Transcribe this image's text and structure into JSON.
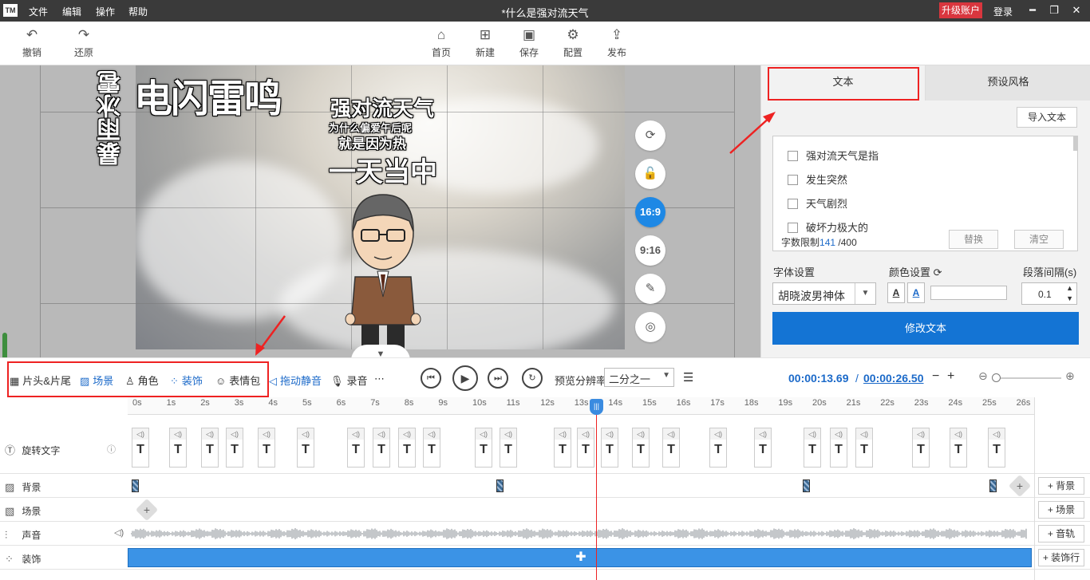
{
  "titlebar": {
    "logo": "TM",
    "menus": [
      "文件",
      "编辑",
      "操作",
      "帮助"
    ],
    "title": "*什么是强对流天气",
    "upgrade": "升级账户",
    "login": "登录"
  },
  "toolbar": {
    "undo": "撤销",
    "redo": "还原",
    "home": "首页",
    "new": "新建",
    "save": "保存",
    "config": "配置",
    "publish": "发布"
  },
  "stage": {
    "vertical_text": "电闪雷鸣",
    "side_text": "暴雨冰雹",
    "line1": "强对流天气",
    "line2": "为什么偏爱午后呢",
    "line3": "就是因为热",
    "line4": "一天当中"
  },
  "side_buttons": {
    "ratio_169": "16:9",
    "ratio_916": "9:16"
  },
  "right_panel": {
    "tab_text": "文本",
    "tab_preset": "预设风格",
    "import": "导入文本",
    "items": [
      "强对流天气是指",
      "发生突然",
      "天气剧烈",
      "破坏力极大的"
    ],
    "char_limit_label": "字数限制",
    "char_count": "141",
    "char_max": "/400",
    "replace": "替换",
    "clear": "清空",
    "font_settings": "字体设置",
    "color_settings": "颜色设置",
    "paragraph_interval": "段落间隔(s)",
    "font_name": "胡晓波男神体",
    "interval_value": "0.1",
    "modify": "修改文本"
  },
  "controls": {
    "head_tail": "片头&片尾",
    "scene": "场景",
    "role": "角色",
    "decor": "装饰",
    "emoji": "表情包",
    "drag_mute": "拖动静音",
    "record": "录音",
    "preview_res_label": "预览分辨率",
    "preview_res_value": "二分之一",
    "current_time": "00:00:13.69",
    "separator": "/",
    "total_time": "00:00:26.50",
    "minus": "−",
    "plus": "+"
  },
  "ruler": [
    "0s",
    "1s",
    "2s",
    "3s",
    "4s",
    "5s",
    "6s",
    "7s",
    "8s",
    "9s",
    "10s",
    "11s",
    "12s",
    "13s",
    "14s",
    "15s",
    "16s",
    "17s",
    "18s",
    "19s",
    "20s",
    "21s",
    "22s",
    "23s",
    "24s",
    "25s",
    "26s"
  ],
  "tracks": {
    "rotate_text": "旋转文字",
    "background": "背景",
    "scene": "场景",
    "audio": "声音",
    "decor": "装饰",
    "add_background": "背景",
    "add_scene": "场景",
    "add_audio": "音轨",
    "add_decor": "装饰行"
  },
  "text_glyph": "T",
  "colors": {
    "accent": "#1474d4",
    "highlight_red": "#e22222",
    "titlebar": "#3a3a3a",
    "upgrade": "#d9363e"
  }
}
